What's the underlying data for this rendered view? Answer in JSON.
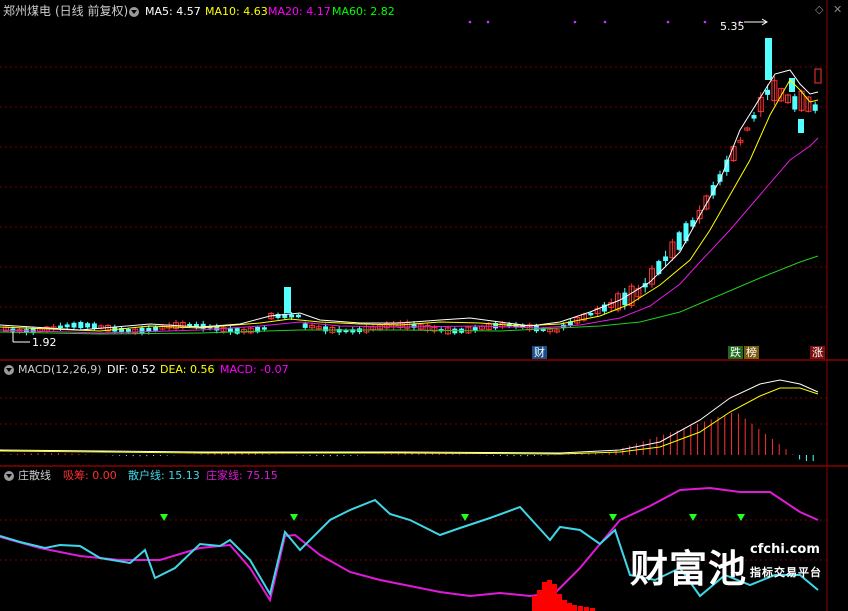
{
  "header": {
    "title": "郑州煤电",
    "mode": "(日线 前复权)",
    "ma5": "MA5: 4.57",
    "ma10": "MA10: 4.63",
    "ma20": "MA20: 4.17",
    "ma60": "MA60: 2.82"
  },
  "price_panel": {
    "high_label": "5.35",
    "low_label": "1.92",
    "tag_cai": "财",
    "tag_die": "跌",
    "tag_bang": "榜",
    "tag_zhang": "涨"
  },
  "macd_panel": {
    "title": "MACD(12,26,9)",
    "dif": "DIF: 0.52",
    "dea": "DEA: 0.56",
    "macd": "MACD: -0.07"
  },
  "zhuang_panel": {
    "title": "庄散线",
    "xichou": "吸筹: 0.00",
    "sanhu": "散户线: 15.13",
    "zhuangjia": "庄家线: 75.15"
  },
  "watermark": {
    "brand": "财富池",
    "url": "cfchi.com",
    "slogan": "指标交易平台"
  },
  "colors": {
    "ma5": "#ffffff",
    "ma10": "#ffff00",
    "ma20": "#ff00ff",
    "ma60": "#00ff00",
    "up": "#ff3232",
    "down": "#54ffff",
    "grid": "#8b0000",
    "sanhu": "#3fd7e8",
    "zhuangjia": "#e01ad8",
    "xichou": "#ff0000"
  },
  "icons": [
    "dropdown-circle-icon",
    "diamond-icon",
    "close-icon"
  ]
}
